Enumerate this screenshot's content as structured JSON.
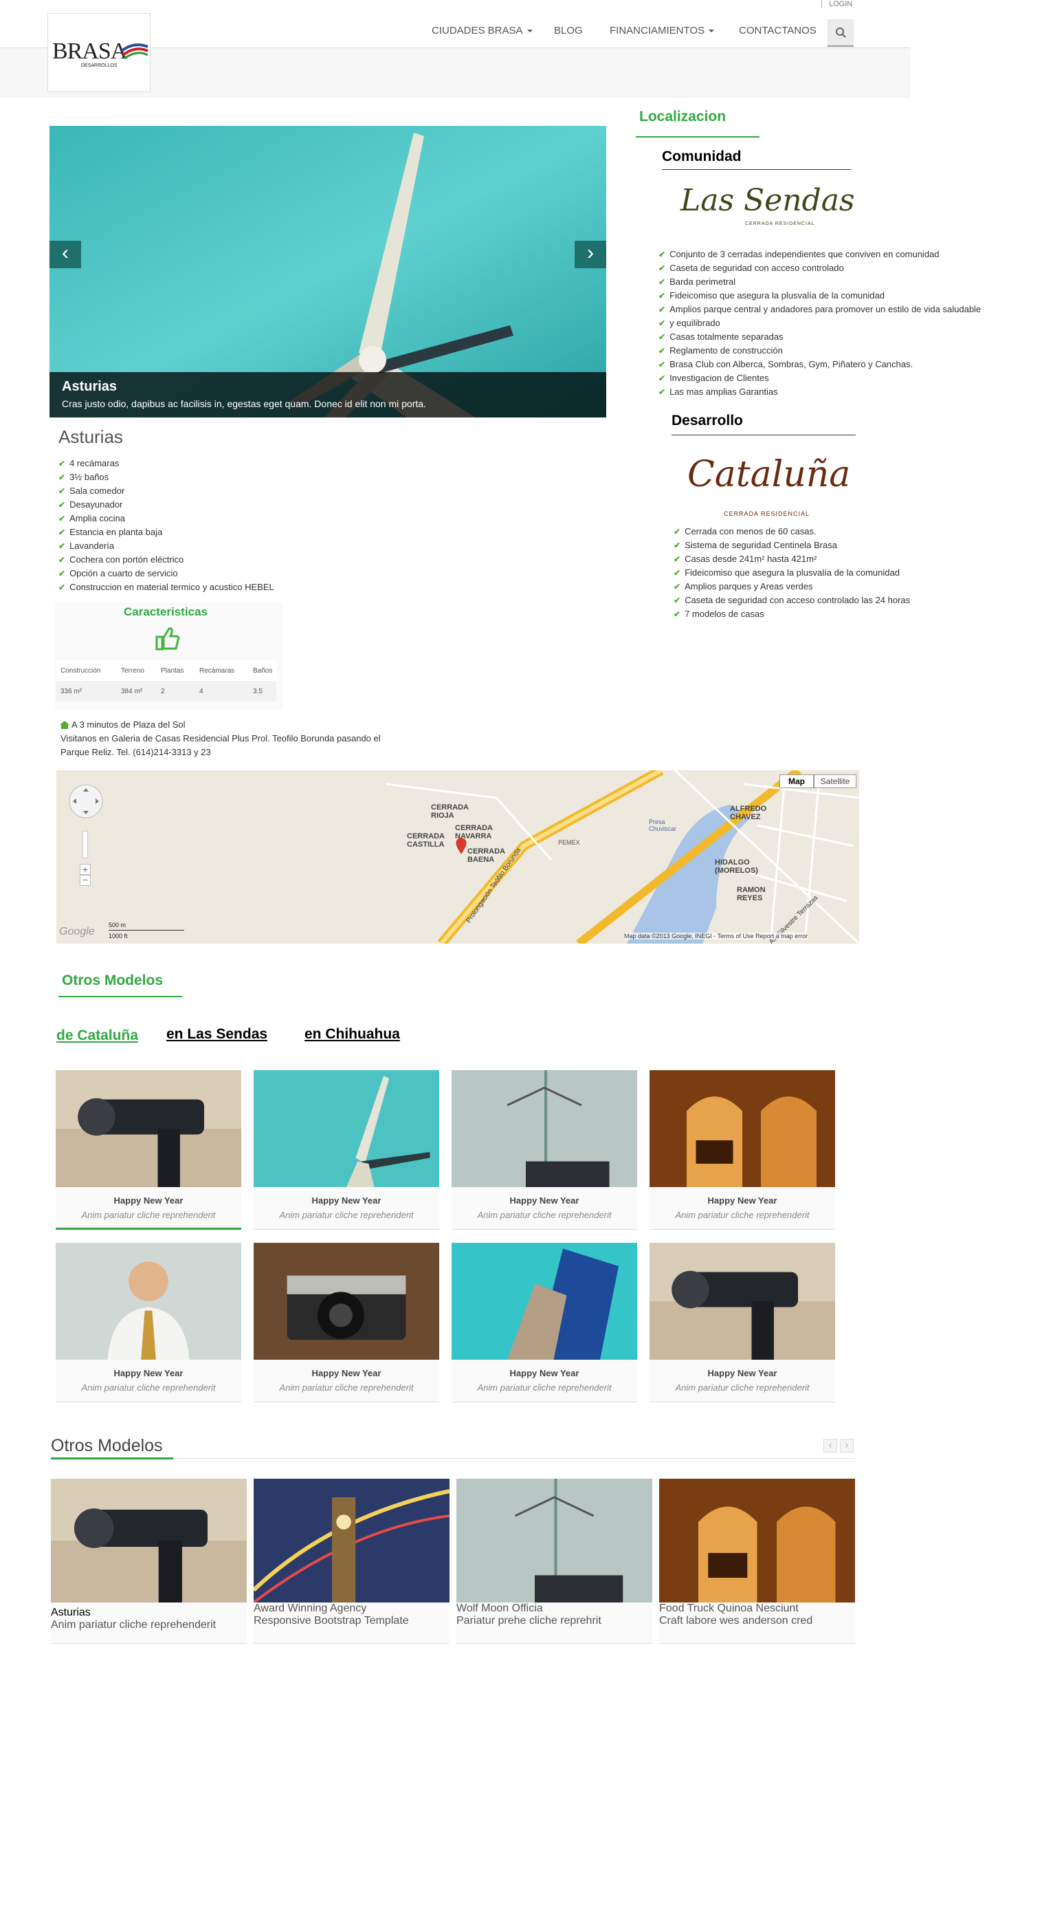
{
  "header": {
    "login": "LOGIN",
    "logo_text": "BRASA",
    "logo_sub": "DESARROLLOS",
    "nav": [
      {
        "label": "CIUDADES BRASA",
        "dropdown": true
      },
      {
        "label": "BLOG",
        "dropdown": false
      },
      {
        "label": "FINANCIAMIENTOS",
        "dropdown": true
      },
      {
        "label": "CONTACTANOS",
        "dropdown": false
      }
    ]
  },
  "slider": {
    "caption_title": "Asturias",
    "caption_text": "Cras justo odio, dapibus ac facilisis in, egestas eget quam. Donec id elit non mi porta.",
    "prev": "‹",
    "next": "›"
  },
  "model": {
    "title": "Asturias",
    "features": [
      "4 recámaras",
      "3½ baños",
      "Sala comedor",
      "Desayunador",
      "Amplia cocina",
      "Estancia en planta baja",
      "Lavandería",
      "Cochera con portón eléctrico",
      "Opción a cuarto de servicio",
      "Construccion en material termico y acustico HEBEL"
    ]
  },
  "caracteristicas": {
    "title": "Caracteristicas",
    "headers": [
      "Construcción",
      "Terreno",
      "Plantas",
      "Recámaras",
      "Baños"
    ],
    "values": [
      "336 m²",
      "384 m²",
      "2",
      "4",
      "3.5"
    ]
  },
  "location": {
    "line1": "A 3 minutos de Plaza del Sol",
    "line2": "Visitanos en Galeria de Casas Residencial Plus Prol. Teofilo Borunda pasando el",
    "line3": "Parque Reliz. Tel. (614)214-3313 y 23"
  },
  "map": {
    "btn_map": "Map",
    "btn_satellite": "Satellite",
    "labels": [
      "CERRADA RIOJA",
      "CERRADA CASTILLA",
      "CERRADA NAVARRA",
      "CERRADA BAENA",
      "ALFREDO CHAVEZ",
      "HIDALGO (MORELOS)",
      "RAMON REYES",
      "Presa Chuviscar",
      "PEMEX",
      "Prolongación Teófilo Borunda",
      "Av. Silvestre Terrazas"
    ],
    "scale_m": "500 m",
    "scale_ft": "1000 ft",
    "attribution": "Map data ©2013 Google, INEGI - Terms of Use  Report a map error",
    "google": "Google"
  },
  "sidebar": {
    "localizacion": "Localizacion",
    "comunidad": "Comunidad",
    "las_sendas_logo": "Las Sendas",
    "las_sendas_sub": "CERRADA RESIDENCIAL",
    "comunidad_items": [
      "Conjunto de 3 cerradas independientes que conviven en comunidad",
      "Caseta de seguridad con acceso controlado",
      "Barda perimetral",
      "Fideicomiso que asegura la plusvalía de la comunidad",
      "Amplios parque central y andadores para promover un estilo de vida saludable",
      "y equilibrado",
      "Casas totalmente separadas",
      "Reglamento de construcción",
      "Brasa Club con Alberca, Sombras, Gym, Piñatero y Canchas.",
      "Investigacion de Clientes",
      "Las mas amplias Garantias"
    ],
    "desarrollo": "Desarrollo",
    "cataluna_logo": "Cataluña",
    "cataluna_sub": "CERRADA RESIDENCIAL",
    "desarrollo_items": [
      "Cerrada con menos de 60 casas.",
      "Sistema de seguridad Centinela Brasa",
      "Casas desde 241m² hasta 421m²",
      "Fideicomiso que asegura la plusvalía de la comunidad",
      "Amplios parques y Areas verdes",
      "Caseta de seguridad con acceso controlado las 24 horas",
      "7 modelos de casas"
    ]
  },
  "otros": {
    "title": "Otros Modelos",
    "tabs": [
      "de Cataluña",
      "en Las Sendas",
      "en Chihuahua"
    ],
    "cards": [
      {
        "title": "Happy New Year",
        "sub": "Anim pariatur cliche reprehenderit",
        "img": "camera-lens"
      },
      {
        "title": "Happy New Year",
        "sub": "Anim pariatur cliche reprehenderit",
        "img": "wind-turbine"
      },
      {
        "title": "Happy New Year",
        "sub": "Anim pariatur cliche reprehenderit",
        "img": "hanger-books"
      },
      {
        "title": "Happy New Year",
        "sub": "Anim pariatur cliche reprehenderit",
        "img": "arches-room"
      },
      {
        "title": "Happy New Year",
        "sub": "Anim pariatur cliche reprehenderit",
        "img": "businessman"
      },
      {
        "title": "Happy New Year",
        "sub": "Anim pariatur cliche reprehenderit",
        "img": "retro-camera"
      },
      {
        "title": "Happy New Year",
        "sub": "Anim pariatur cliche reprehenderit",
        "img": "building"
      },
      {
        "title": "Happy New Year",
        "sub": "Anim pariatur cliche reprehenderit",
        "img": "camera-lens"
      }
    ]
  },
  "otros2": {
    "title": "Otros Modelos",
    "cards": [
      {
        "title": "Asturias",
        "sub": "Anim pariatur cliche reprehenderit",
        "img": "camera-lens"
      },
      {
        "title": "Award Winning Agency",
        "sub": "Responsive Bootstrap Template",
        "img": "big-ben"
      },
      {
        "title": "Wolf Moon Officia",
        "sub": "Pariatur prehe cliche reprehrit",
        "img": "hanger-books"
      },
      {
        "title": "Food Truck Quinoa Nesciunt",
        "sub": "Craft labore wes anderson cred",
        "img": "arches-room"
      }
    ]
  },
  "colors": {
    "accent": "#31a843",
    "teal": "#1f6f6d",
    "checks": "#56ab35"
  }
}
